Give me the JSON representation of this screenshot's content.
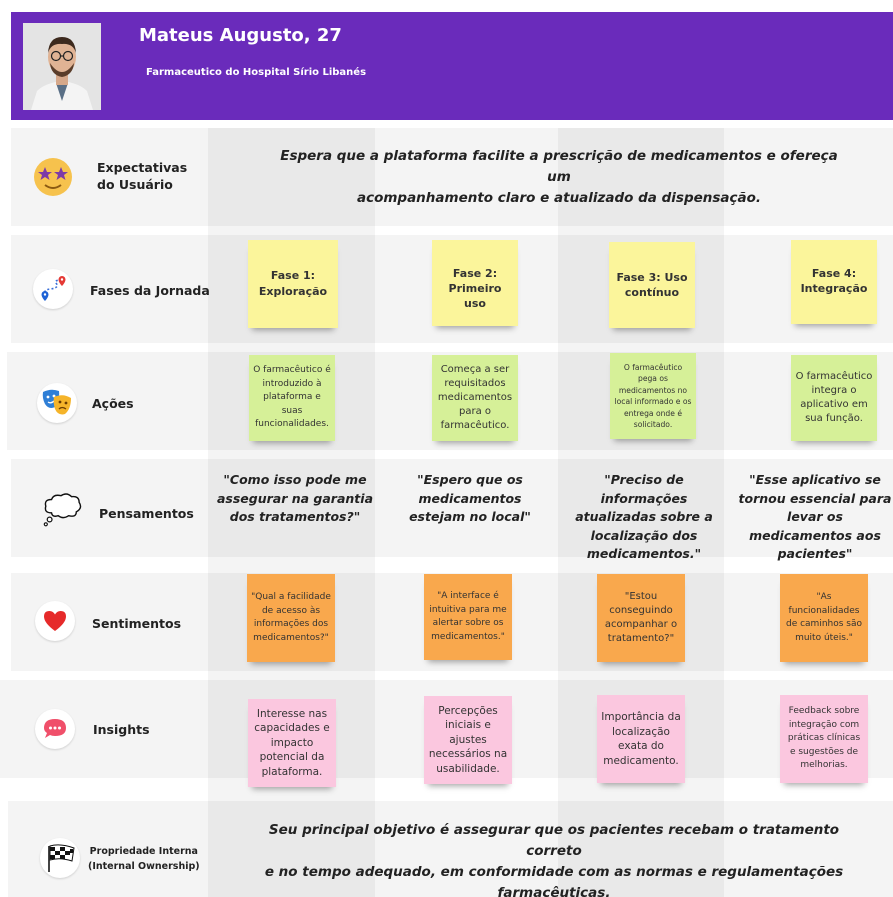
{
  "persona": {
    "name": "Mateus Augusto, 27",
    "role": "Farmaceutico do Hospital Sírio Libanés"
  },
  "rows": {
    "expectations": {
      "label_line1": "Expectativas",
      "label_line2": "do Usuário",
      "icon": "star-eyes-emoji-icon",
      "text_line1": "Espera que a plataforma facilite a prescrição de medicamentos e ofereça um",
      "text_line2": "acompanhamento claro e atualizado da dispensação."
    },
    "phases": {
      "label": "Fases da Jornada",
      "icon": "route-map-icon",
      "notes": [
        {
          "line1": "Fase 1:",
          "line2": "Exploração"
        },
        {
          "line1": "Fase 2:",
          "line2": "Primeiro uso"
        },
        {
          "line1": "Fase 3: Uso",
          "line2": "contínuo"
        },
        {
          "line1": "Fase 4:",
          "line2": "Integração"
        }
      ]
    },
    "actions": {
      "label": "Ações",
      "icon": "theater-masks-icon",
      "notes": [
        "O farmacêutico é introduzido à plataforma e suas funcionalidades.",
        "Começa a ser requisitados medicamentos para o farmacêutico.",
        "O farmacêutico pega os medicamentos no local informado e os entrega onde é solicitado.",
        "O farmacêutico integra o aplicativo em sua função."
      ]
    },
    "thoughts": {
      "label": "Pensamentos",
      "icon": "thought-bubble-icon",
      "items": [
        "\"Como isso pode me assegurar na garantia dos tratamentos?\"",
        "\"Espero que os medicamentos estejam no local\"",
        "\"Preciso de informações atualizadas sobre a localização dos medicamentos.\"",
        "\"Esse aplicativo se tornou essencial para levar os medicamentos aos pacientes\""
      ]
    },
    "feelings": {
      "label": "Sentimentos",
      "icon": "red-heart-icon",
      "notes": [
        "\"Qual a facilidade de acesso às informações dos medicamentos?\"",
        "\"A interface é intuitiva para me alertar sobre os medicamentos.\"",
        "\"Estou conseguindo acompanhar o tratamento?\"",
        "\"As funcionalidades de caminhos são muito úteis.\""
      ]
    },
    "insights": {
      "label": "Insights",
      "icon": "speech-bubble-icon",
      "notes": [
        "Interesse nas capacidades e impacto potencial da plataforma.",
        "Percepções iniciais e ajustes necessários na usabilidade.",
        "Importância da localização exata do medicamento.",
        "Feedback sobre integração com práticas clínicas e sugestões de melhorias."
      ]
    },
    "ownership": {
      "label_line1": "Propriedade Interna",
      "label_line2": "(Internal Ownership)",
      "icon": "checkered-flag-icon",
      "text_line1": "Seu principal objetivo é assegurar que os pacientes recebam o tratamento correto",
      "text_line2": "e no tempo adequado, em conformidade com as normas e  regulamentações",
      "text_line3": "farmacêuticas."
    }
  },
  "colors": {
    "header": "#6a2bbb",
    "yellow_note": "#fbf59b",
    "green_note": "#d6f098",
    "orange_note": "#f9a84d",
    "pink_note": "#fbc7df"
  }
}
